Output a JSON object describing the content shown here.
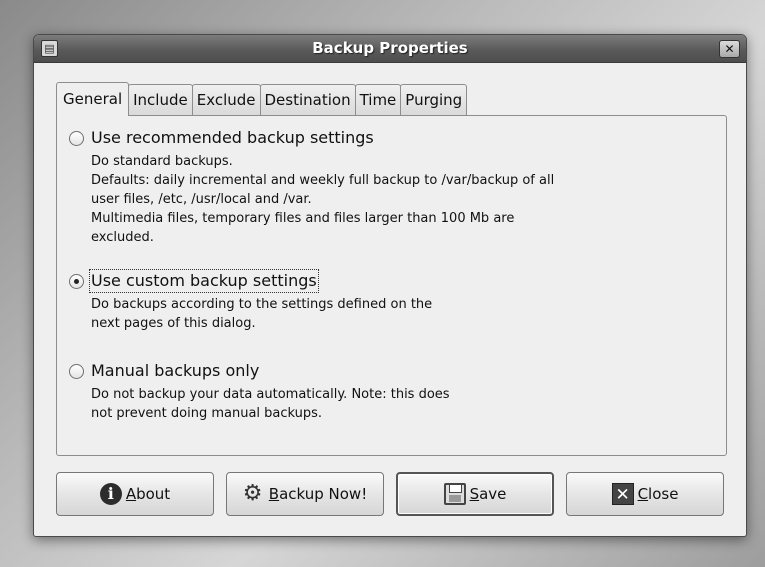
{
  "window": {
    "title": "Backup Properties",
    "close_symbol": "✕"
  },
  "tabs": [
    {
      "label": "General",
      "active": true
    },
    {
      "label": "Include",
      "active": false
    },
    {
      "label": "Exclude",
      "active": false
    },
    {
      "label": "Destination",
      "active": false
    },
    {
      "label": "Time",
      "active": false
    },
    {
      "label": "Purging",
      "active": false
    }
  ],
  "options": [
    {
      "label": "Use recommended backup settings",
      "checked": false,
      "description": [
        "Do standard backups.",
        "Defaults: daily incremental and weekly full backup to /var/backup of all",
        "user files, /etc, /usr/local and /var.",
        "Multimedia files, temporary files and files larger than 100 Mb are",
        "excluded."
      ]
    },
    {
      "label": "Use custom backup settings",
      "checked": true,
      "description": [
        "Do backups according to the settings defined on the",
        "next pages of this dialog."
      ]
    },
    {
      "label": "Manual backups only",
      "checked": false,
      "description": [
        "Do not backup your data automatically. Note: this does",
        "not prevent doing manual backups."
      ]
    }
  ],
  "buttons": {
    "about": {
      "mnemonic": "A",
      "rest": "bout",
      "icon": "info-icon"
    },
    "backup_now": {
      "mnemonic": "B",
      "rest": "ackup Now!",
      "icon": "gears-icon"
    },
    "save": {
      "mnemonic": "S",
      "rest": "ave",
      "icon": "floppy-icon"
    },
    "close": {
      "mnemonic": "C",
      "rest": "lose",
      "icon": "close-icon"
    }
  }
}
